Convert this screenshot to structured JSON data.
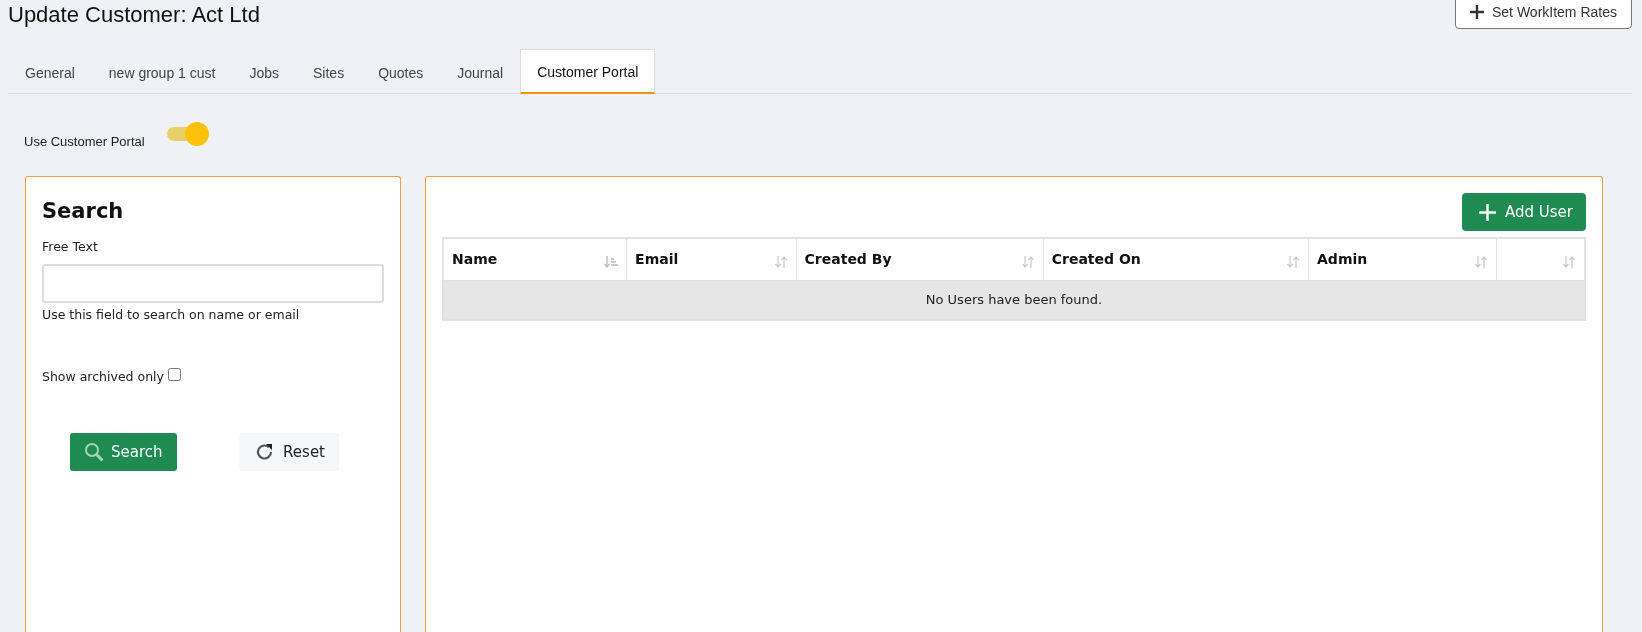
{
  "page": {
    "title": "Update Customer: Act Ltd",
    "action_button": "Set WorkItem Rates"
  },
  "tabs": [
    {
      "label": "General",
      "selected": false
    },
    {
      "label": "new group 1 cust",
      "selected": false
    },
    {
      "label": "Jobs",
      "selected": false
    },
    {
      "label": "Sites",
      "selected": false
    },
    {
      "label": "Quotes",
      "selected": false
    },
    {
      "label": "Journal",
      "selected": false
    },
    {
      "label": "Customer Portal",
      "selected": true
    }
  ],
  "portal_toggle": {
    "label": "Use Customer Portal",
    "on": true
  },
  "search_panel": {
    "title": "Search",
    "field_label": "Free Text",
    "field_help": "Use this field to search on name or email",
    "archived_label": "Show archived only",
    "archived_checked": false,
    "search_button": "Search",
    "reset_button": "Reset"
  },
  "users_panel": {
    "add_button": "Add User",
    "columns": [
      {
        "label": "Name",
        "sorted": true
      },
      {
        "label": "Email",
        "sorted": false
      },
      {
        "label": "Created By",
        "sorted": false
      },
      {
        "label": "Created On",
        "sorted": false
      },
      {
        "label": "Admin",
        "sorted": false
      },
      {
        "sorted": false
      }
    ],
    "empty_message": "No Users have been found."
  }
}
